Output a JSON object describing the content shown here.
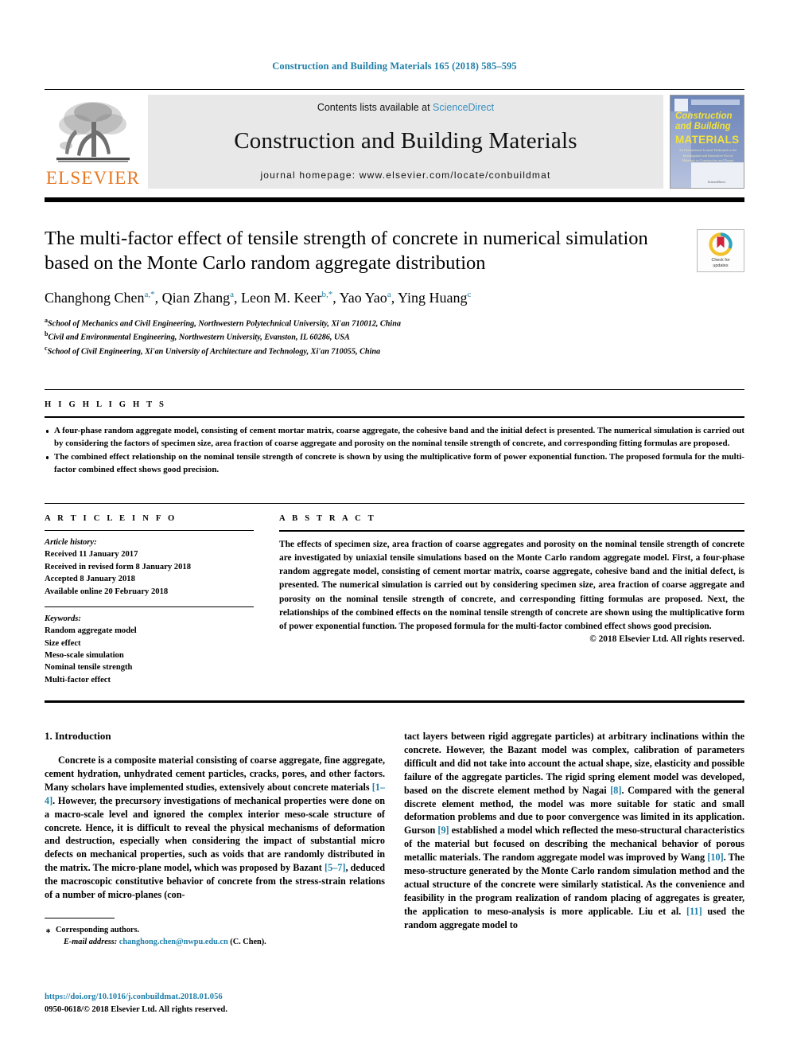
{
  "running_head": "Construction and Building Materials 165 (2018) 585–595",
  "masthead": {
    "publisher_logo_text": "ELSEVIER",
    "contents_prefix": "Contents lists available at ",
    "contents_link": "ScienceDirect",
    "journal_title": "Construction and Building Materials",
    "homepage_label": "journal homepage: www.elsevier.com/locate/conbuildmat",
    "cover": {
      "line1": "Construction",
      "line2": "and Building",
      "line3": "MATERIALS",
      "blurb": "An International Journal Dedicated to the Investigation and Innovative Use of Materials in Construction and Repair",
      "footer": "ScienceDirect"
    }
  },
  "article": {
    "title": "The multi-factor effect of tensile strength of concrete in numerical simulation based on the Monte Carlo random aggregate distribution",
    "authors": [
      {
        "name": "Changhong Chen",
        "marks": "a,*"
      },
      {
        "name": "Qian Zhang",
        "marks": "a"
      },
      {
        "name": "Leon M. Keer",
        "marks": "b,*"
      },
      {
        "name": "Yao Yao",
        "marks": "a"
      },
      {
        "name": "Ying Huang",
        "marks": "c"
      }
    ],
    "affiliations": [
      {
        "mark": "a",
        "text": "School of Mechanics and Civil Engineering, Northwestern Polytechnical University, Xi'an 710012, China"
      },
      {
        "mark": "b",
        "text": "Civil and Environmental Engineering, Northwestern University, Evanston, IL 60286, USA"
      },
      {
        "mark": "c",
        "text": "School of Civil Engineering, Xi'an University of Architecture and Technology, Xi'an 710055, China"
      }
    ],
    "crossmark": {
      "line1": "Check for",
      "line2": "updates"
    }
  },
  "highlights": {
    "heading": "H I G H L I G H T S",
    "items": [
      "A four-phase random aggregate model, consisting of cement mortar matrix, coarse aggregate, the cohesive band and the initial defect is presented. The numerical simulation is carried out by considering the factors of specimen size, area fraction of coarse aggregate and porosity on the nominal tensile strength of concrete, and corresponding fitting formulas are proposed.",
      "The combined effect relationship on the nominal tensile strength of concrete is shown by using the multiplicative form of power exponential function. The proposed formula for the multi-factor combined effect shows good precision."
    ]
  },
  "article_info": {
    "heading": "A R T I C L E    I N F O",
    "history_label": "Article history:",
    "history": [
      "Received 11 January 2017",
      "Received in revised form 8 January 2018",
      "Accepted 8 January 2018",
      "Available online 20 February 2018"
    ],
    "keywords_label": "Keywords:",
    "keywords": [
      "Random aggregate model",
      "Size effect",
      "Meso-scale simulation",
      "Nominal tensile strength",
      "Multi-factor effect"
    ]
  },
  "abstract": {
    "heading": "A B S T R A C T",
    "text": "The effects of specimen size, area fraction of coarse aggregates and porosity on the nominal tensile strength of concrete are investigated by uniaxial tensile simulations based on the Monte Carlo random aggregate model. First, a four-phase random aggregate model, consisting of cement mortar matrix, coarse aggregate, cohesive band and the initial defect, is presented. The numerical simulation is carried out by considering specimen size, area fraction of coarse aggregate and porosity on the nominal tensile strength of concrete, and corresponding fitting formulas are proposed. Next, the relationships of the combined effects on the nominal tensile strength of concrete are shown using the multiplicative form of power exponential function. The proposed formula for the multi-factor combined effect shows good precision.",
    "copyright": "© 2018 Elsevier Ltd. All rights reserved."
  },
  "body": {
    "section_heading": "1. Introduction",
    "left_paragraph_part1": "Concrete is a composite material consisting of coarse aggregate, fine aggregate, cement hydration, unhydrated cement particles, cracks, pores, and other factors. Many scholars have implemented studies, extensively about concrete materials ",
    "left_ref1": "[1–4]",
    "left_paragraph_part2": ". However, the precursory investigations of mechanical properties were done on a macro-scale level and ignored the complex interior meso-scale structure of concrete. Hence, it is difficult to reveal the physical mechanisms of deformation and destruction, especially when considering the impact of substantial micro defects on mechanical properties, such as voids that are randomly distributed in the matrix. The micro-plane model, which was proposed by Bazant ",
    "left_ref2": "[5–7]",
    "left_paragraph_part3": ", deduced the macroscopic constitutive behavior of concrete from the stress-strain relations of a number of micro-planes (con-",
    "right_paragraph_part1": "tact layers between rigid aggregate particles) at arbitrary inclinations within the concrete. However, the Bazant model was complex, calibration of parameters difficult and did not take into account the actual shape, size, elasticity and possible failure of the aggregate particles. The rigid spring element model was developed, based on the discrete element method by Nagai ",
    "right_ref1": "[8]",
    "right_paragraph_part2": ". Compared with the general discrete element method, the model was more suitable for static and small deformation problems and due to poor convergence was limited in its application. Gurson ",
    "right_ref2": "[9]",
    "right_paragraph_part3": " established a model which reflected the meso-structural characteristics of the material but focused on describing the mechanical behavior of porous metallic materials. The random aggregate model was improved by Wang ",
    "right_ref3": "[10]",
    "right_paragraph_part4": ". The meso-structure generated by the Monte Carlo random simulation method and the actual structure of the concrete were similarly statistical. As the convenience and feasibility in the program realization of random placing of aggregates is greater, the application to meso-analysis is more applicable. Liu et al. ",
    "right_ref4": "[11]",
    "right_paragraph_part5": " used the random aggregate model to"
  },
  "footnote": {
    "star": "⁎",
    "corresponding": "Corresponding authors.",
    "email_label": "E-mail address:",
    "email": "changhong.chen@nwpu.edu.cn",
    "email_suffix": "(C. Chen)."
  },
  "footer": {
    "doi": "https://doi.org/10.1016/j.conbuildmat.2018.01.056",
    "issn_line": "0950-0618/© 2018 Elsevier Ltd. All rights reserved."
  },
  "colors": {
    "link_blue": "#1f7fa8",
    "sciencedirect_blue": "#3a8fc0",
    "elsevier_orange": "#e87722",
    "band_grey": "#e8e8e8",
    "cover_blue": "#7e93c2",
    "cover_yellow": "#f2e23c"
  }
}
